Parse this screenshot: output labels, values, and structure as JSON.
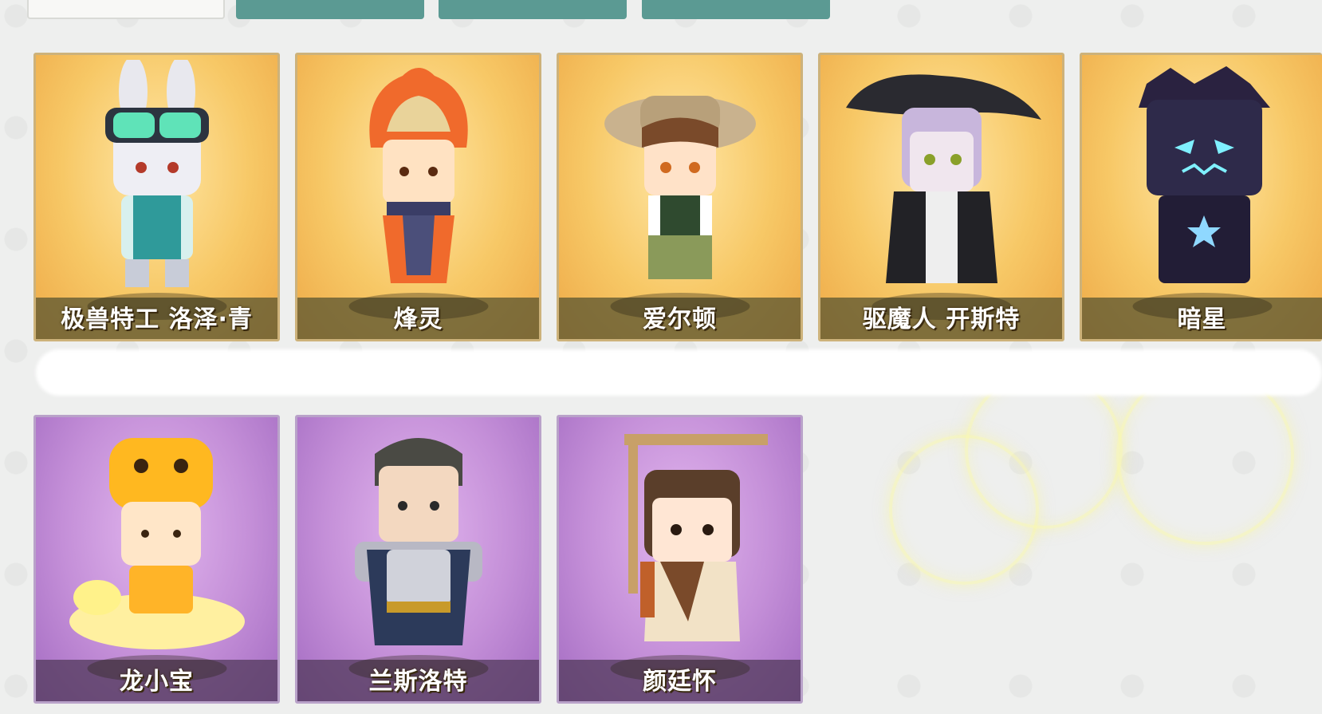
{
  "row1": [
    {
      "name": "极兽特工 洛泽·青",
      "icon": "rabbit-goggles"
    },
    {
      "name": "烽灵",
      "icon": "flame-hair"
    },
    {
      "name": "爱尔顿",
      "icon": "explorer-hat"
    },
    {
      "name": "驱魔人 开斯特",
      "icon": "witch-hat"
    },
    {
      "name": "暗星",
      "icon": "dark-cube"
    }
  ],
  "row2": [
    {
      "name": "龙小宝",
      "icon": "dragon-baby"
    },
    {
      "name": "兰斯洛特",
      "icon": "armored-knight"
    },
    {
      "name": "颜廷怀",
      "icon": "scroll-backpack"
    }
  ],
  "colors": {
    "gold_card": "#f7c866",
    "purple_card": "#c48fd8",
    "tab_teal": "#5b9a93"
  }
}
